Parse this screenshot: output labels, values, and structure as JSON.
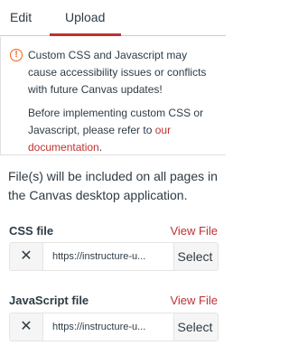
{
  "tabs": [
    {
      "label": "Edit"
    },
    {
      "label": "Upload"
    }
  ],
  "warning": {
    "icon": "!",
    "text1": "Custom CSS and Javascript may cause accessibility issues or conflicts with future Canvas updates!",
    "text2_prefix": "Before implementing custom CSS or Javascript, please refer to ",
    "text2_link": "our documentation",
    "text2_suffix": "."
  },
  "info_text": "File(s) will be included on all pages in the Canvas desktop application.",
  "css_file": {
    "label": "CSS file",
    "view_label": "View File",
    "clear_icon": "✕",
    "url": "https://instructure-u...",
    "select_label": "Select"
  },
  "js_file": {
    "label": "JavaScript file",
    "view_label": "View File",
    "clear_icon": "✕",
    "url": "https://instructure-u...",
    "select_label": "Select"
  },
  "colors": {
    "accent": "#bf3131",
    "warning": "#fc5e13",
    "text": "#2d3b45"
  }
}
